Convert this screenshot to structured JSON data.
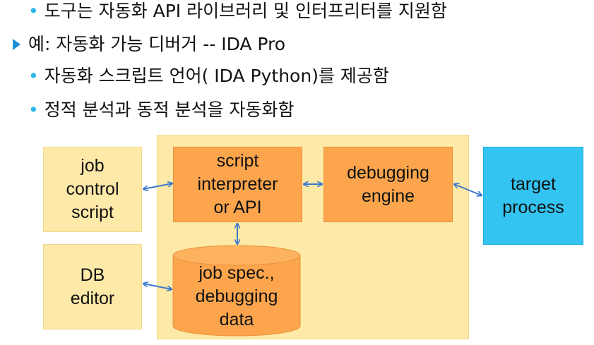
{
  "bullets": [
    {
      "level": 2,
      "text": "도구는 자동화 API 라이브러리 및 인터프리터를 지원함"
    },
    {
      "level": 1,
      "text": "예: 자동화 가능 디버거 -- IDA Pro"
    },
    {
      "level": 2,
      "text": "자동화 스크립트 언어( IDA Python)를 제공함"
    },
    {
      "level": 2,
      "text": "정적 분석과 동적 분석을 자동화함"
    }
  ],
  "diagram": {
    "job_control_script": "job\ncontrol\nscript",
    "db_editor": "DB\neditor",
    "script_interpreter": "script\ninterpreter\nor API",
    "debugging_engine": "debugging\nengine",
    "target_process": "target\nprocess",
    "job_spec_data": "job spec.,\ndebugging\ndata"
  },
  "colors": {
    "cream": "#fde9a8",
    "orange": "#fca54d",
    "blue": "#33c4f1",
    "arrow": "#3a78c9",
    "bullet": "#2bb5e8"
  }
}
